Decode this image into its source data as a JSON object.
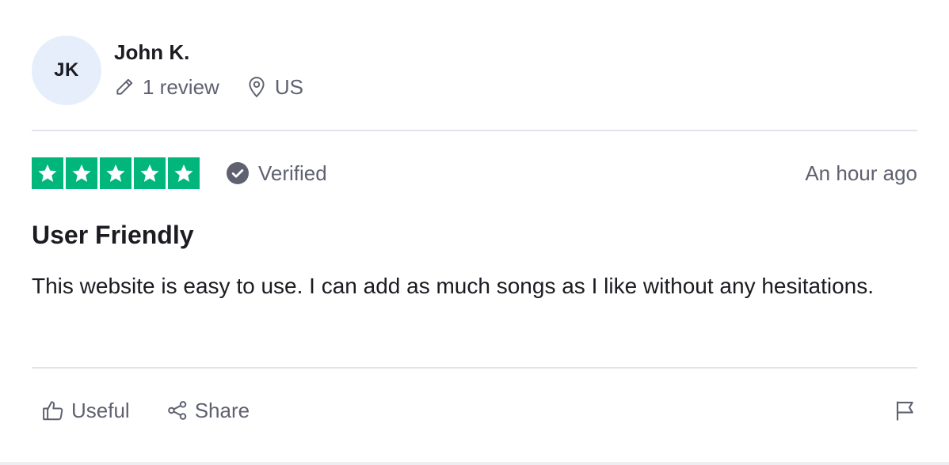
{
  "reviewer": {
    "initials": "JK",
    "name": "John K.",
    "review_count": "1 review",
    "country": "US"
  },
  "review": {
    "rating": 5,
    "rating_max": 5,
    "verified_label": "Verified",
    "date": "An hour ago",
    "title": "User Friendly",
    "body": "This website is easy to use. I can add as much songs as I like without any hesitations."
  },
  "actions": {
    "useful_label": "Useful",
    "share_label": "Share"
  },
  "icons": {
    "pencil": "pencil-icon",
    "location": "location-pin-icon",
    "star": "star-icon",
    "verified": "check-circle-icon",
    "thumbs_up": "thumbs-up-icon",
    "share": "share-icon",
    "flag": "flag-icon"
  },
  "colors": {
    "star_green": "#00b67a",
    "avatar_bg": "#e5eefa",
    "muted_text": "#5f6170",
    "text": "#1b1b21"
  }
}
